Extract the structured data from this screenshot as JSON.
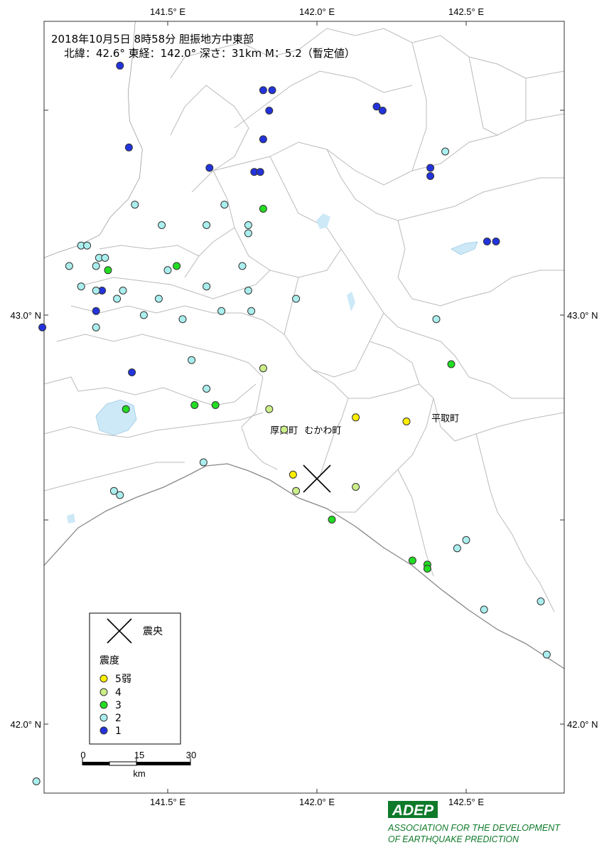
{
  "title": {
    "line1": "2018年10月5日 8時58分  胆振地方中東部",
    "line2": "北緯：42.6° 東経：142.0° 深さ：31km  M：5.2（暫定値）"
  },
  "axes": {
    "lon_ticks": [
      "141.5° E",
      "142.0° E",
      "142.5° E"
    ],
    "lat_ticks": [
      "43.0° N",
      "42.0° N"
    ]
  },
  "epicenter": {
    "lon": 142.0,
    "lat": 42.6,
    "label": "震央"
  },
  "towns": [
    {
      "name": "厚真町",
      "lon": 141.89,
      "lat": 42.71
    },
    {
      "name": "むかわ町",
      "lon": 142.02,
      "lat": 42.71
    },
    {
      "name": "平取町",
      "lon": 142.43,
      "lat": 42.74
    }
  ],
  "legend": {
    "epicenter_label": "震央",
    "intensity_title": "震度",
    "items": [
      {
        "label": "5弱",
        "key": "5-",
        "color": "#ffee00"
      },
      {
        "label": "4",
        "key": "4",
        "color": "#ccee88"
      },
      {
        "label": "3",
        "key": "3",
        "color": "#22dd22"
      },
      {
        "label": "2",
        "key": "2",
        "color": "#aaeeee"
      },
      {
        "label": "1",
        "key": "1",
        "color": "#2233dd"
      }
    ]
  },
  "scale_bar": {
    "ticks": [
      "0",
      "15",
      "30"
    ],
    "unit": "km"
  },
  "stations": [
    {
      "lon": 141.34,
      "lat": 43.61,
      "i": "1"
    },
    {
      "lon": 141.82,
      "lat": 43.55,
      "i": "1"
    },
    {
      "lon": 141.85,
      "lat": 43.55,
      "i": "1"
    },
    {
      "lon": 141.84,
      "lat": 43.5,
      "i": "1"
    },
    {
      "lon": 142.2,
      "lat": 43.51,
      "i": "1"
    },
    {
      "lon": 142.22,
      "lat": 43.5,
      "i": "1"
    },
    {
      "lon": 141.37,
      "lat": 43.41,
      "i": "1"
    },
    {
      "lon": 141.82,
      "lat": 43.43,
      "i": "1"
    },
    {
      "lon": 141.64,
      "lat": 43.36,
      "i": "1"
    },
    {
      "lon": 141.79,
      "lat": 43.35,
      "i": "1"
    },
    {
      "lon": 141.81,
      "lat": 43.35,
      "i": "1"
    },
    {
      "lon": 142.38,
      "lat": 43.36,
      "i": "1"
    },
    {
      "lon": 142.38,
      "lat": 43.34,
      "i": "1"
    },
    {
      "lon": 142.57,
      "lat": 43.18,
      "i": "1"
    },
    {
      "lon": 142.6,
      "lat": 43.18,
      "i": "1"
    },
    {
      "lon": 141.28,
      "lat": 43.06,
      "i": "1"
    },
    {
      "lon": 141.26,
      "lat": 43.01,
      "i": "1"
    },
    {
      "lon": 141.08,
      "lat": 42.97,
      "i": "1"
    },
    {
      "lon": 141.38,
      "lat": 42.86,
      "i": "1"
    },
    {
      "lon": 141.82,
      "lat": 43.26,
      "i": "3"
    },
    {
      "lon": 141.3,
      "lat": 43.11,
      "i": "3"
    },
    {
      "lon": 141.53,
      "lat": 43.12,
      "i": "3"
    },
    {
      "lon": 142.45,
      "lat": 42.88,
      "i": "3"
    },
    {
      "lon": 141.36,
      "lat": 42.77,
      "i": "3"
    },
    {
      "lon": 141.59,
      "lat": 42.78,
      "i": "3"
    },
    {
      "lon": 141.66,
      "lat": 42.78,
      "i": "3"
    },
    {
      "lon": 142.05,
      "lat": 42.5,
      "i": "3"
    },
    {
      "lon": 142.32,
      "lat": 42.4,
      "i": "3"
    },
    {
      "lon": 142.37,
      "lat": 42.39,
      "i": "3"
    },
    {
      "lon": 142.37,
      "lat": 42.38,
      "i": "3"
    },
    {
      "lon": 141.82,
      "lat": 42.87,
      "i": "4"
    },
    {
      "lon": 141.84,
      "lat": 42.77,
      "i": "4"
    },
    {
      "lon": 141.89,
      "lat": 42.72,
      "i": "4"
    },
    {
      "lon": 141.93,
      "lat": 42.57,
      "i": "4"
    },
    {
      "lon": 142.13,
      "lat": 42.58,
      "i": "4"
    },
    {
      "lon": 142.13,
      "lat": 42.75,
      "i": "5-"
    },
    {
      "lon": 142.3,
      "lat": 42.74,
      "i": "5-"
    },
    {
      "lon": 141.92,
      "lat": 42.61,
      "i": "5-"
    },
    {
      "lon": 142.43,
      "lat": 43.4,
      "i": "2"
    },
    {
      "lon": 141.39,
      "lat": 43.27,
      "i": "2"
    },
    {
      "lon": 141.48,
      "lat": 43.22,
      "i": "2"
    },
    {
      "lon": 141.63,
      "lat": 43.22,
      "i": "2"
    },
    {
      "lon": 141.69,
      "lat": 43.27,
      "i": "2"
    },
    {
      "lon": 141.77,
      "lat": 43.22,
      "i": "2"
    },
    {
      "lon": 141.77,
      "lat": 43.2,
      "i": "2"
    },
    {
      "lon": 141.21,
      "lat": 43.17,
      "i": "2"
    },
    {
      "lon": 141.23,
      "lat": 43.17,
      "i": "2"
    },
    {
      "lon": 141.27,
      "lat": 43.14,
      "i": "2"
    },
    {
      "lon": 141.29,
      "lat": 43.14,
      "i": "2"
    },
    {
      "lon": 141.17,
      "lat": 43.12,
      "i": "2"
    },
    {
      "lon": 141.26,
      "lat": 43.12,
      "i": "2"
    },
    {
      "lon": 141.5,
      "lat": 43.11,
      "i": "2"
    },
    {
      "lon": 141.75,
      "lat": 43.12,
      "i": "2"
    },
    {
      "lon": 141.21,
      "lat": 43.07,
      "i": "2"
    },
    {
      "lon": 141.26,
      "lat": 43.06,
      "i": "2"
    },
    {
      "lon": 141.35,
      "lat": 43.06,
      "i": "2"
    },
    {
      "lon": 141.33,
      "lat": 43.04,
      "i": "2"
    },
    {
      "lon": 141.47,
      "lat": 43.04,
      "i": "2"
    },
    {
      "lon": 141.63,
      "lat": 43.07,
      "i": "2"
    },
    {
      "lon": 141.77,
      "lat": 43.06,
      "i": "2"
    },
    {
      "lon": 141.93,
      "lat": 43.04,
      "i": "2"
    },
    {
      "lon": 141.42,
      "lat": 43.0,
      "i": "2"
    },
    {
      "lon": 141.55,
      "lat": 42.99,
      "i": "2"
    },
    {
      "lon": 141.68,
      "lat": 43.01,
      "i": "2"
    },
    {
      "lon": 141.78,
      "lat": 43.01,
      "i": "2"
    },
    {
      "lon": 142.4,
      "lat": 42.99,
      "i": "2"
    },
    {
      "lon": 141.26,
      "lat": 42.97,
      "i": "2"
    },
    {
      "lon": 141.58,
      "lat": 42.89,
      "i": "2"
    },
    {
      "lon": 141.63,
      "lat": 42.82,
      "i": "2"
    },
    {
      "lon": 141.62,
      "lat": 42.64,
      "i": "2"
    },
    {
      "lon": 141.32,
      "lat": 42.57,
      "i": "2"
    },
    {
      "lon": 141.34,
      "lat": 42.56,
      "i": "2"
    },
    {
      "lon": 142.47,
      "lat": 42.43,
      "i": "2"
    },
    {
      "lon": 142.5,
      "lat": 42.45,
      "i": "2"
    },
    {
      "lon": 142.56,
      "lat": 42.28,
      "i": "2"
    },
    {
      "lon": 142.75,
      "lat": 42.3,
      "i": "2"
    },
    {
      "lon": 142.77,
      "lat": 42.17,
      "i": "2"
    },
    {
      "lon": 141.06,
      "lat": 41.86,
      "i": "2"
    }
  ],
  "logo": {
    "mark": "ADEP",
    "line1": "ASSOCIATION FOR THE DEVELOPMENT",
    "line2": "OF EARTHQUAKE PREDICTION"
  }
}
